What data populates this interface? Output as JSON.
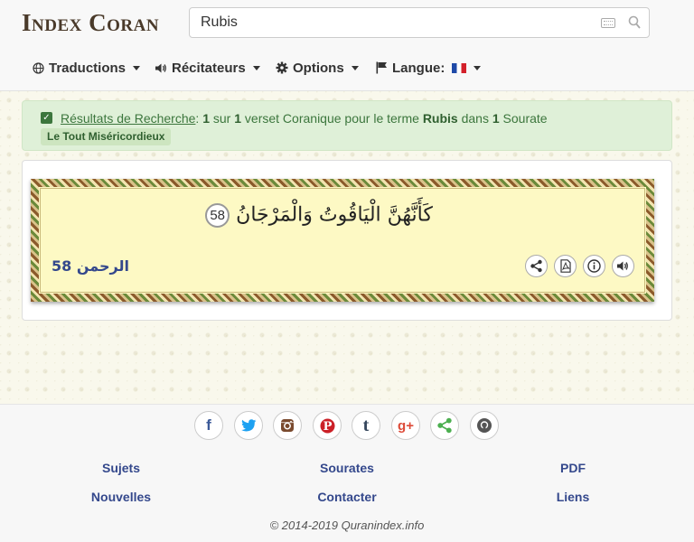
{
  "header": {
    "logo": "Index Coran",
    "search": {
      "value": "Rubis",
      "placeholder": ""
    },
    "nav": [
      {
        "label": "Traductions"
      },
      {
        "label": "Récitateurs"
      },
      {
        "label": "Options"
      },
      {
        "label": "Langue:"
      }
    ]
  },
  "alert": {
    "results_link": "Résultats de Recherche",
    "colon": ":",
    "count": "1",
    "sur": "sur",
    "total": "1",
    "mid": "verset Coranique pour le terme",
    "term": "Rubis",
    "dans": "dans",
    "surah_count": "1",
    "sourate": "Sourate",
    "badge": "Le Tout Miséricordieux"
  },
  "verse": {
    "text": "كَأَنَّهُنَّ الْيَاقُوتُ وَالْمَرْجَانُ",
    "number": "58",
    "reference": "الرحمن 58"
  },
  "footer": {
    "links": [
      "Sujets",
      "Sourates",
      "PDF",
      "Nouvelles",
      "Contacter",
      "Liens"
    ],
    "social": [
      "facebook-icon",
      "twitter-icon",
      "instagram-icon",
      "pinterest-icon",
      "tumblr-icon",
      "google-plus-icon",
      "share-icon",
      "github-icon"
    ],
    "copyright": "© 2014-2019 Quranindex.info"
  },
  "colors": {
    "link": "#34488c",
    "alert_bg": "#dff0d8",
    "verse_bg": "#fdf9c4"
  }
}
